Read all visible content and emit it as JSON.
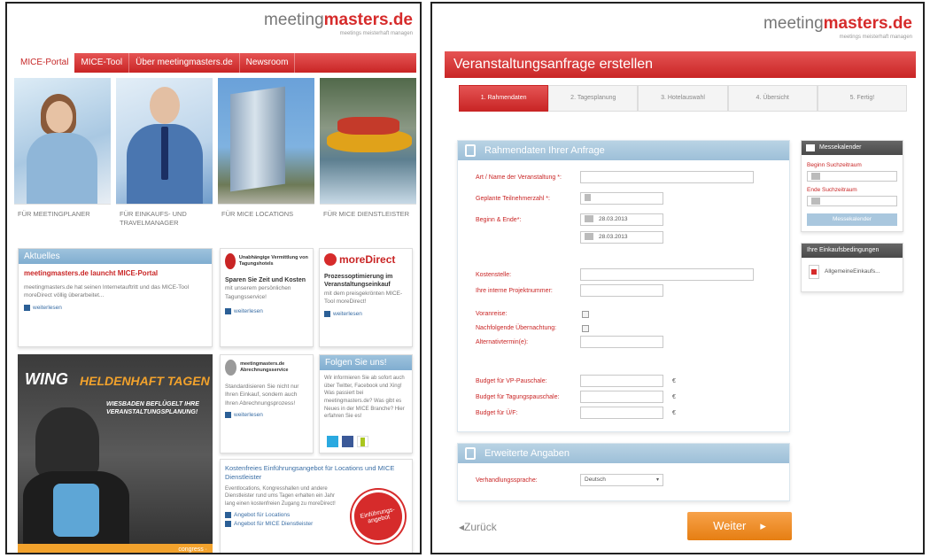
{
  "left": {
    "logo": {
      "brand_plain": "meeting",
      "brand_bold": "masters.de",
      "tagline": "meetings meisterhaft managen"
    },
    "nav": [
      "MICE-Portal",
      "MICE-Tool",
      "Über meetingmasters.de",
      "Newsroom"
    ],
    "tiles": [
      "FÜR MEETINGPLANER",
      "FÜR EINKAUFS- UND TRAVELMANAGER",
      "FÜR MICE LOCATIONS",
      "FÜR MICE DIENSTLEISTER"
    ],
    "news": {
      "header": "Aktuelles",
      "title": "meetingmasters.de launcht MICE-Portal",
      "text": "meetingmasters.de hat seinen Internetauftritt und das MICE-Tool moreDirect völlig überarbeitet...",
      "more": "weiterlesen"
    },
    "box2": {
      "logo_text": "Unabhängige Vermittlung von Tagungshotels",
      "title": "Sparen Sie Zeit und Kosten",
      "text": "mit unserem persönlichen Tagungsservice!",
      "more": "weiterlesen"
    },
    "box3": {
      "brand": "moreDirect",
      "title": "Prozessoptimierung im Veranstaltungseinkauf",
      "text": "mit dem preisgekrönten MICE-Tool moreDirect!",
      "more": "weiterlesen"
    },
    "ad": {
      "brand": "WING",
      "headline": "HELDENHAFT TAGEN",
      "sub": "WIESBADEN BEFLÜGELT IHRE VERANSTALTUNGSPLANUNG!",
      "footer": "congress ·"
    },
    "box4": {
      "logo_text": "meetingmasters.de Abrechnungsservice",
      "text": "Standardisieren Sie nicht nur Ihren Einkauf, sondern auch Ihren Abrechnungsprozess!",
      "more": "weiterlesen"
    },
    "follow": {
      "header": "Folgen Sie uns!",
      "text": "Wir informieren Sie ab sofort auch über Twitter, Facebook und Xing! Was passiert bei meetingmasters.de? Was gibt es Neues in der MICE Branche? Hier erfahren Sie es!"
    },
    "offer": {
      "title": "Kostenfreies Einführungsangebot für Locations und MICE Dienstleister",
      "text": "Eventlocations, Kongresshallen und andere Dienstleister rund ums Tagen erhalten ein Jahr lang einen kostenfreien Zugang zu moreDirect!",
      "link1": "Angebot für Locations",
      "link2": "Angebot für MICE Dienstleister",
      "badge": "Einführungs-angebot"
    }
  },
  "right": {
    "logo": {
      "brand_plain": "meeting",
      "brand_bold": "masters.de",
      "tagline": "meetings meisterhaft managen"
    },
    "title": "Veranstaltungsanfrage erstellen",
    "steps": [
      "1. Rahmendaten",
      "2. Tagesplanung",
      "3. Hotelauswahl",
      "4. Übersicht",
      "5. Fertig!"
    ],
    "panel1": {
      "header": "Rahmendaten Ihrer Anfrage",
      "labels": {
        "event": "Art / Name der Veranstaltung *:",
        "participants": "Geplante Teilnehmerzahl *:",
        "dates": "Beginn & Ende*:",
        "cost_center": "Kostenstelle:",
        "project_no": "Ihre interne Projektnummer:",
        "pre_arrival": "Voranreise:",
        "extra_night": "Nachfolgende Übernachtung:",
        "alt_date": "Alternativtermin(e):",
        "budget_vp": "Budget für VP-Pauschale:",
        "budget_tagung": "Budget für Tagungspauschale:",
        "budget_uf": "Budget für Ü/F:"
      },
      "start_date": "28.03.2013",
      "end_date": "28.03.2013",
      "currency": "€"
    },
    "panel2": {
      "header": "Erweiterte Angaben",
      "language_label": "Verhandlungssprache:",
      "language_value": "Deutsch"
    },
    "calendar": {
      "header": "Messekalender",
      "start_label": "Beginn Suchzeitraum",
      "end_label": "Ende Suchzeitraum",
      "button": "Messekalender"
    },
    "terms": {
      "header": "Ihre Einkaufsbedingungen",
      "file": "AllgemeineEinkaufs..."
    },
    "back": "Zurück",
    "next": "Weiter"
  }
}
